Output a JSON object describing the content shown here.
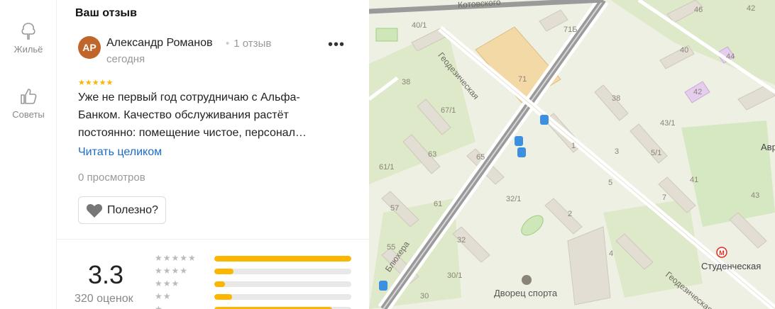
{
  "rail": {
    "housing_label": "Жильё",
    "tips_label": "Советы"
  },
  "review": {
    "section_title": "Ваш отзыв",
    "avatar_initials": "АР",
    "author": "Александр Романов",
    "author_reviews": "1 отзыв",
    "date": "сегодня",
    "more_label": "•••",
    "stars": "★★★★★",
    "rating_stars": 5,
    "text": "Уже не первый год сотрудничаю с Альфа-Банком. Качество обслуживания растёт постоянно: помещение чистое, персонал…",
    "read_more": "Читать целиком",
    "views": "0 просмотров",
    "helpful_label": "Полезно?"
  },
  "summary": {
    "rating": "3.3",
    "count_label": "320 оценок",
    "distribution": [
      {
        "stars": "★★★★★",
        "fraction": 1.0
      },
      {
        "stars": "★★★★",
        "fraction": 0.14
      },
      {
        "stars": "★★★",
        "fraction": 0.08
      },
      {
        "stars": "★★",
        "fraction": 0.13
      },
      {
        "stars": "★",
        "fraction": 0.86
      }
    ]
  },
  "map": {
    "street_kotovskogo": "Котовского",
    "street_geodezicheskaya_1": "Геодезическая",
    "street_geodezicheskaya_2": "Геодезическая",
    "street_blyukhera": "Блюхера",
    "metro_name": "Студенческая",
    "poi_dvorets": "Дворец спорта",
    "poi_partial": "Авр",
    "houses": [
      "40/1",
      "71Б",
      "46",
      "42",
      "40",
      "44",
      "42",
      "38",
      "71",
      "67/1",
      "38",
      "43/1",
      "63",
      "65",
      "1",
      "3",
      "5/1",
      "61/1",
      "5",
      "41",
      "7",
      "43",
      "57",
      "61",
      "32/1",
      "2",
      "55",
      "32",
      "4",
      "30/1",
      "30"
    ]
  },
  "colors": {
    "accent": "#fcb600",
    "link": "#1a6dc9",
    "avatar": "#c1662a",
    "metro": "#e52b1e"
  }
}
